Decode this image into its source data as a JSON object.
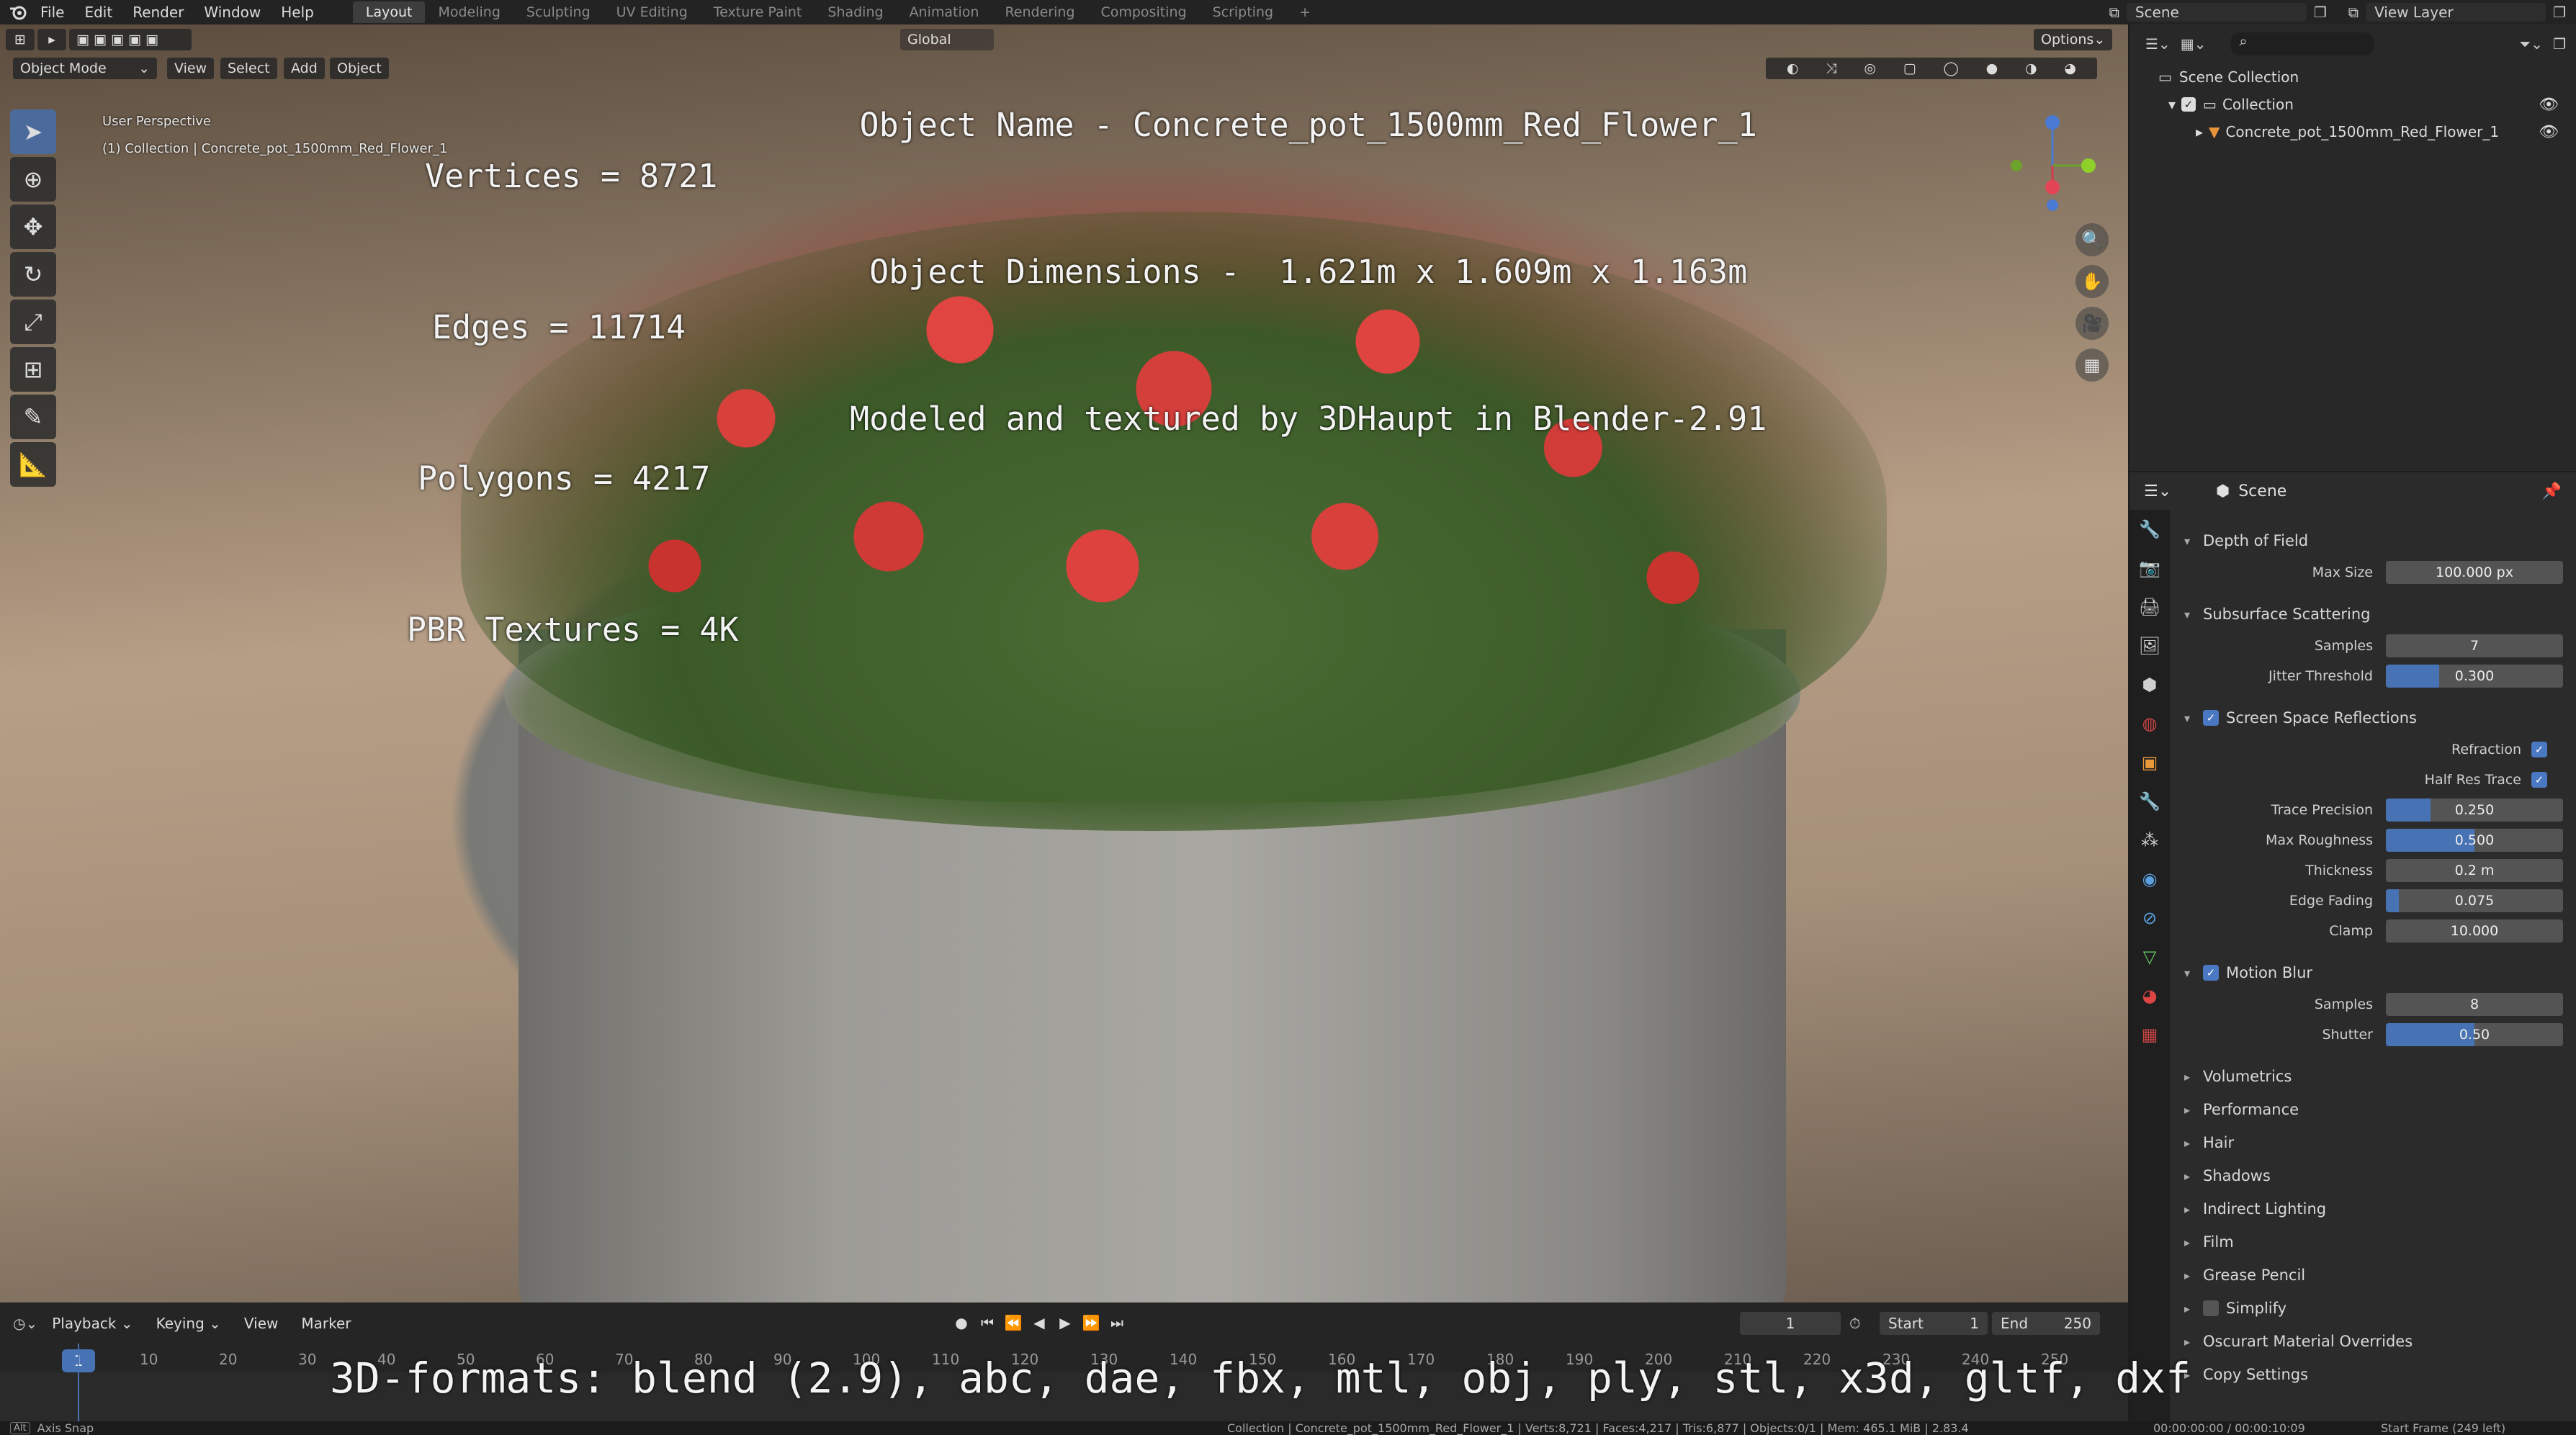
{
  "topbar": {
    "menus": [
      "File",
      "Edit",
      "Render",
      "Window",
      "Help"
    ],
    "tabs": [
      "Layout",
      "Modeling",
      "Sculpting",
      "UV Editing",
      "Texture Paint",
      "Shading",
      "Animation",
      "Rendering",
      "Compositing",
      "Scripting"
    ],
    "active_tab": "Layout",
    "scene": "Scene",
    "view_layer": "View Layer"
  },
  "viewport": {
    "mode": "Object Mode",
    "menus": [
      "View",
      "Select",
      "Add",
      "Object"
    ],
    "transform_orientation": "Global",
    "options": "Options",
    "perspective": "User Perspective",
    "collection_info": "(1) Collection | Concrete_pot_1500mm_Red_Flower_1"
  },
  "overlay": {
    "vertices": "Vertices = 8721",
    "edges": "Edges = 11714",
    "polygons": "Polygons = 4217",
    "pbr": "PBR Textures = 4K",
    "object_name": "Object Name - Concrete_pot_1500mm_Red_Flower_1",
    "object_dimensions": "Object Dimensions -  1.621m x 1.609m x 1.163m",
    "modeled_by": "Modeled and textured by 3DHaupt in Blender-2.91",
    "formats": "3D-formats: blend (2.9), abc, dae, fbx, mtl, obj, ply, stl, x3d, gltf, dxf"
  },
  "outliner": {
    "scene_collection": "Scene Collection",
    "collection": "Collection",
    "object": "Concrete_pot_1500mm_Red_Flower_1"
  },
  "properties": {
    "context": "Scene",
    "depth_of_field": {
      "title": "Depth of Field",
      "max_size_label": "Max Size",
      "max_size": "100.000 px"
    },
    "subsurface": {
      "title": "Subsurface Scattering",
      "samples_label": "Samples",
      "samples": "7",
      "jitter_label": "Jitter Threshold",
      "jitter": "0.300",
      "jitter_fill": 0.3
    },
    "ssr": {
      "title": "Screen Space Reflections",
      "refraction": "Refraction",
      "half_res": "Half Res Trace",
      "trace_precision_label": "Trace Precision",
      "trace_precision": "0.250",
      "trace_precision_fill": 0.25,
      "max_roughness_label": "Max Roughness",
      "max_roughness": "0.500",
      "max_roughness_fill": 0.5,
      "thickness_label": "Thickness",
      "thickness": "0.2 m",
      "edge_fading_label": "Edge Fading",
      "edge_fading": "0.075",
      "edge_fading_fill": 0.075,
      "clamp_label": "Clamp",
      "clamp": "10.000"
    },
    "motion_blur": {
      "title": "Motion Blur",
      "samples_label": "Samples",
      "samples": "8",
      "shutter_label": "Shutter",
      "shutter": "0.50",
      "shutter_fill": 0.5
    },
    "collapsed": [
      "Volumetrics",
      "Performance",
      "Hair",
      "Shadows",
      "Indirect Lighting",
      "Film",
      "Grease Pencil",
      "Simplify",
      "Oscurart Material Overrides",
      "Copy Settings"
    ]
  },
  "timeline": {
    "menus": [
      "Playback",
      "Keying",
      "View",
      "Marker"
    ],
    "current_frame": "1",
    "frame_field": "1",
    "start_label": "Start",
    "start": "1",
    "end_label": "End",
    "end": "250",
    "ruler": [
      "10",
      "20",
      "30",
      "40",
      "50",
      "60",
      "70",
      "80",
      "90",
      "100",
      "110",
      "120",
      "130",
      "140",
      "150",
      "160",
      "170",
      "180",
      "190",
      "200",
      "210",
      "220",
      "230",
      "240",
      "250"
    ]
  },
  "statusbar": {
    "left": "Axis Snap",
    "center": "Collection | Concrete_pot_1500mm_Red_Flower_1 | Verts:8,721 | Faces:4,217 | Tris:6,877 | Objects:0/1 | Mem: 465.1 MiB | 2.83.4",
    "timecode": "00:00:00:00 / 00:00:10:09",
    "start_frame": "Start Frame (249 left)"
  },
  "colors": {
    "accent": "#4772b3",
    "background": "#1d1d1d",
    "panel": "#2b2b2b"
  }
}
